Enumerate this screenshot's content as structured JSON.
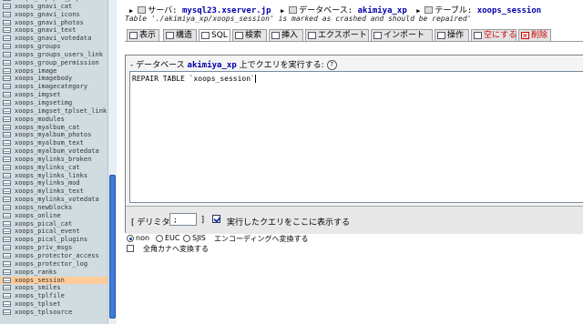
{
  "sidebar": {
    "tables": [
      "xoops_d3pipes_pipes",
      "xoops_gnavi_cat",
      "xoops_gnavi_icons",
      "xoops_gnavi_photos",
      "xoops_gnavi_text",
      "xoops_gnavi_votedata",
      "xoops_groups",
      "xoops_groups_users_link",
      "xoops_group_permission",
      "xoops_image",
      "xoops_imagebody",
      "xoops_imagecategory",
      "xoops_imgset",
      "xoops_imgsetimg",
      "xoops_imgset_tplset_link",
      "xoops_modules",
      "xoops_myalbum_cat",
      "xoops_myalbum_photos",
      "xoops_myalbum_text",
      "xoops_myalbum_votedata",
      "xoops_mylinks_broken",
      "xoops_mylinks_cat",
      "xoops_mylinks_links",
      "xoops_mylinks_mod",
      "xoops_mylinks_text",
      "xoops_mylinks_votedata",
      "xoops_newblocks",
      "xoops_online",
      "xoops_pical_cat",
      "xoops_pical_event",
      "xoops_pical_plugins",
      "xoops_priv_msgs",
      "xoops_protector_access",
      "xoops_protector_log",
      "xoops_ranks",
      "xoops_session",
      "xoops_smiles",
      "xoops_tplfile",
      "xoops_tplset",
      "xoops_tplsource"
    ],
    "selected_index": 35
  },
  "breadcrumb": {
    "server_label": "サーバ:",
    "server_value": "mysql23.xserver.jp",
    "database_label": "データベース:",
    "database_value": "akimiya_xp",
    "table_label": "テーブル:",
    "table_value": "xoops_session",
    "separator": "▶"
  },
  "notice": "Table './akimiya_xp/xoops_session' is marked as crashed and should be repaired'",
  "tabs": [
    {
      "label": "表示",
      "icon": "browse-icon"
    },
    {
      "label": "構造",
      "icon": "structure-icon"
    },
    {
      "label": "SQL",
      "icon": "sql-icon"
    },
    {
      "label": "検索",
      "icon": "search-icon"
    },
    {
      "label": "挿入",
      "icon": "insert-icon"
    },
    {
      "label": "エクスポート",
      "icon": "export-icon"
    },
    {
      "label": "インポート",
      "icon": "import-icon"
    },
    {
      "label": "操作",
      "icon": "operations-icon"
    },
    {
      "label": "空にする",
      "icon": "empty-icon"
    },
    {
      "label": "削除",
      "icon": "drop-icon"
    }
  ],
  "active_tab": "SQL",
  "query_panel": {
    "legend_prefix": "データベース",
    "database": "akimiya_xp",
    "legend_suffix": "上でクエリを実行する:",
    "help_symbol": "?",
    "sql_text": "REPAIR TABLE `xoops_session`",
    "delimiter_label": "[ デリミタ",
    "delimiter_value": ";",
    "delimiter_close": "]",
    "show_query_label": "実行したクエリをここに表示する",
    "show_query_checked": true
  },
  "encoding": {
    "options": [
      "non",
      "EUC",
      "SJIS"
    ],
    "selected": "non",
    "label": "エンコーディングへ変換する",
    "kana_label": "全角カナへ変換する",
    "kana_checked": false
  },
  "colors": {
    "sidebar_bg": "#d0dce0",
    "selected_row": "#ffcc99",
    "link_blue": "#0000aa",
    "danger_red": "#cc0000",
    "scroll_thumb": "#3c7cd8"
  }
}
